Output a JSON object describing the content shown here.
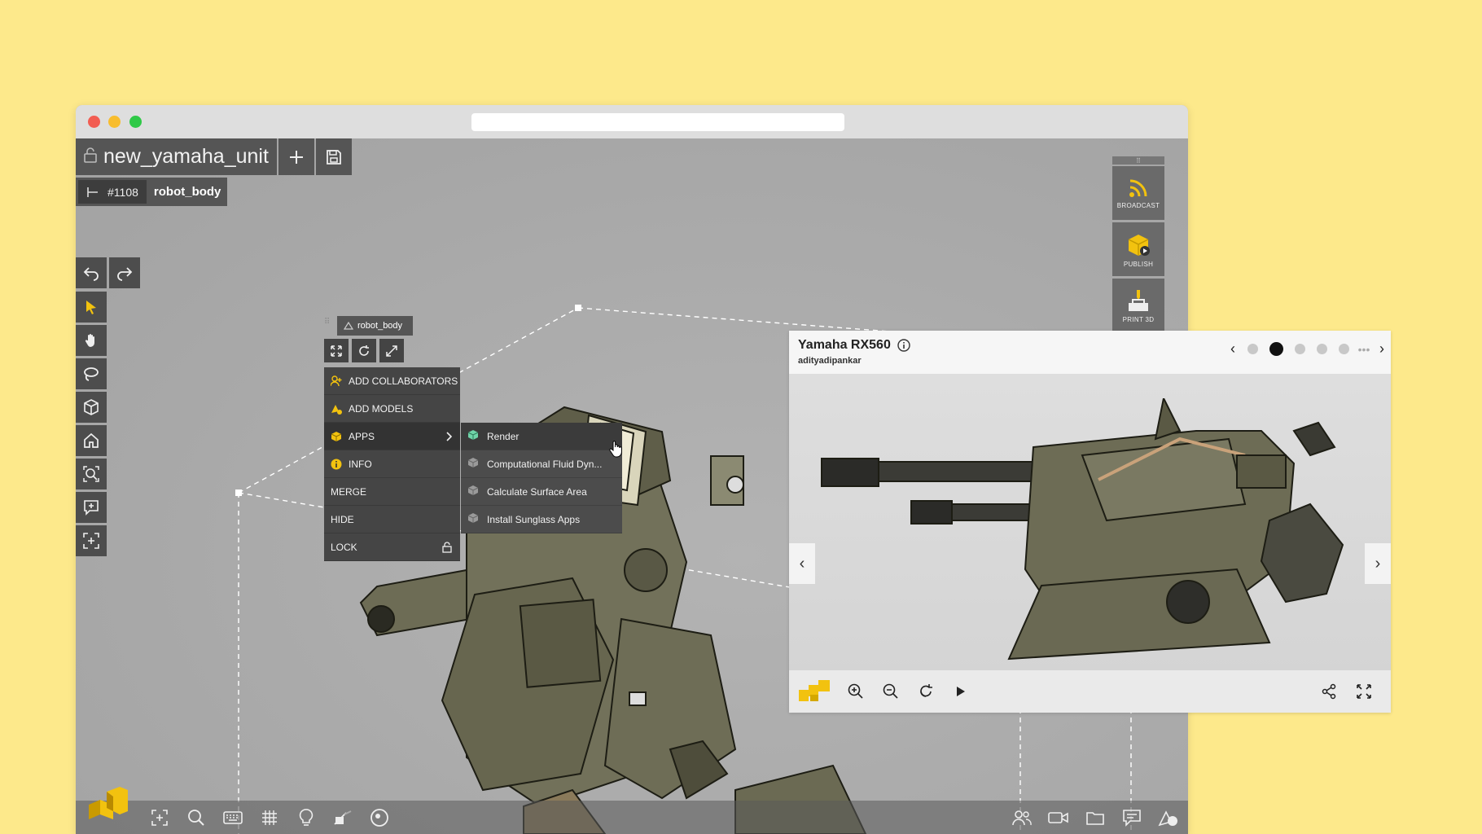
{
  "project": {
    "name": "new_yamaha_unit"
  },
  "path": {
    "id": "#1108",
    "name": "robot_body"
  },
  "context_menu": {
    "title": "robot_body",
    "items": [
      {
        "label": "ADD COLLABORATORS"
      },
      {
        "label": "ADD MODELS"
      },
      {
        "label": "APPS"
      },
      {
        "label": "INFO"
      },
      {
        "label": "MERGE"
      },
      {
        "label": "HIDE"
      },
      {
        "label": "LOCK"
      }
    ],
    "apps_submenu": [
      {
        "label": "Render"
      },
      {
        "label": "Computational Fluid Dyn..."
      },
      {
        "label": "Calculate Surface Area"
      },
      {
        "label": "Install Sunglass Apps"
      }
    ]
  },
  "right_panel": {
    "broadcast": "BROADCAST",
    "publish": "PUBLISH",
    "print3d": "PRINT 3D"
  },
  "viewer": {
    "title": "Yamaha RX560",
    "author": "adityadipankar",
    "current_page": 2,
    "total_pages_visible": 5
  },
  "colors": {
    "background": "#fde98b",
    "accent": "#f2c20f",
    "toolbar": "#4d4d4d"
  }
}
